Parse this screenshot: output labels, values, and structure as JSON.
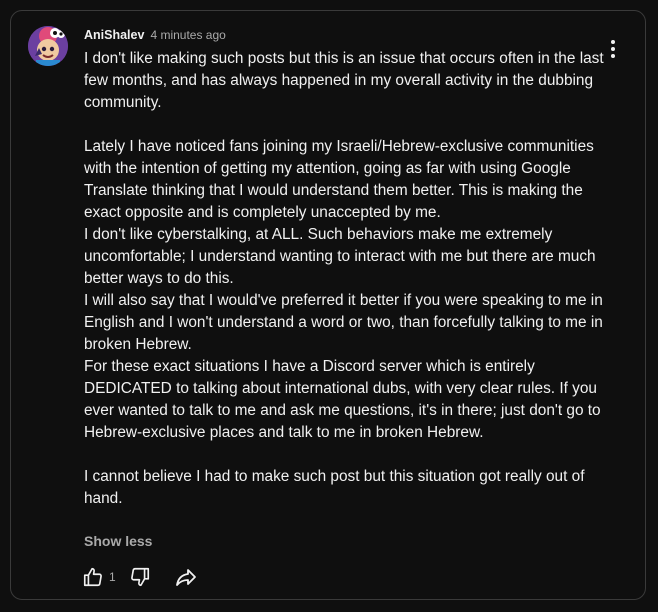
{
  "comment": {
    "author": "AniShalev",
    "timestamp": "4 minutes ago",
    "paragraphs": [
      "I don't like making such posts but this is an issue that occurs often in the last few months, and has always happened in my overall activity in the dubbing community.",
      "",
      "Lately I have noticed fans joining my Israeli/Hebrew-exclusive communities with the intention of getting my attention, going as far with using Google Translate thinking that I would understand them better. This is making the exact opposite and is completely unaccepted by me.",
      "I don't like cyberstalking, at ALL. Such behaviors make me extremely uncomfortable; I understand wanting to interact with me but there are much better ways to do this.",
      "I will also say that I would've preferred it better if you were speaking to me in English and I won't understand a word or two, than forcefully talking to me in broken Hebrew.",
      "For these exact situations I have a Discord server which is entirely DEDICATED to talking about international dubs, with very clear rules. If you ever wanted to talk to me and ask me questions, it's in there; just don't go to Hebrew-exclusive places and talk to me in broken Hebrew.",
      "",
      "I cannot believe I had to make such post but this situation got really out of hand."
    ],
    "show_less_label": "Show less",
    "like_count": "1"
  },
  "icons": {
    "avatar": "cartoon-character-avatar",
    "menu": "more-vertical-icon",
    "like": "thumbs-up-icon",
    "dislike": "thumbs-down-icon",
    "share": "share-arrow-icon"
  },
  "colors": {
    "background": "#0f0f0f",
    "border": "#3a3a3a",
    "text_primary": "#f1f1f1",
    "text_secondary": "#aaaaaa",
    "avatar_bg": "#6b3fa0"
  }
}
